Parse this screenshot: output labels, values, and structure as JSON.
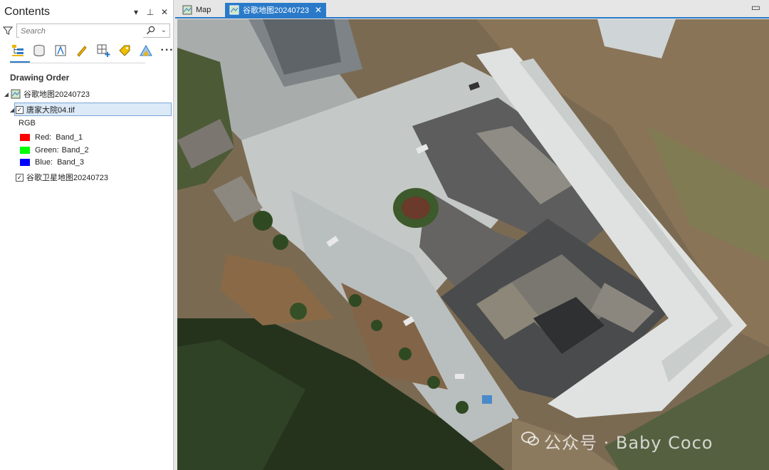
{
  "contents": {
    "title": "Contents",
    "controls": [
      "▾",
      "⊥",
      "✕"
    ],
    "search_placeholder": "Search",
    "drawing_order": "Drawing Order",
    "map_name": "谷歌地图20240723",
    "layer_name": "唐家大院04.tif",
    "rgb_label": "RGB",
    "bands": [
      {
        "name": "Red:",
        "band": "Band_1",
        "color": "#ff0000"
      },
      {
        "name": "Green:",
        "band": "Band_2",
        "color": "#00ff00"
      },
      {
        "name": "Blue:",
        "band": "Band_3",
        "color": "#0000ff"
      }
    ],
    "basemap_name": "谷歌卫星地图20240723"
  },
  "tabs": [
    {
      "label": "Map"
    },
    {
      "label": "谷歌地图20240723"
    }
  ],
  "watermark": "公众号 · Baby Coco",
  "accent": "#2a7ac9"
}
